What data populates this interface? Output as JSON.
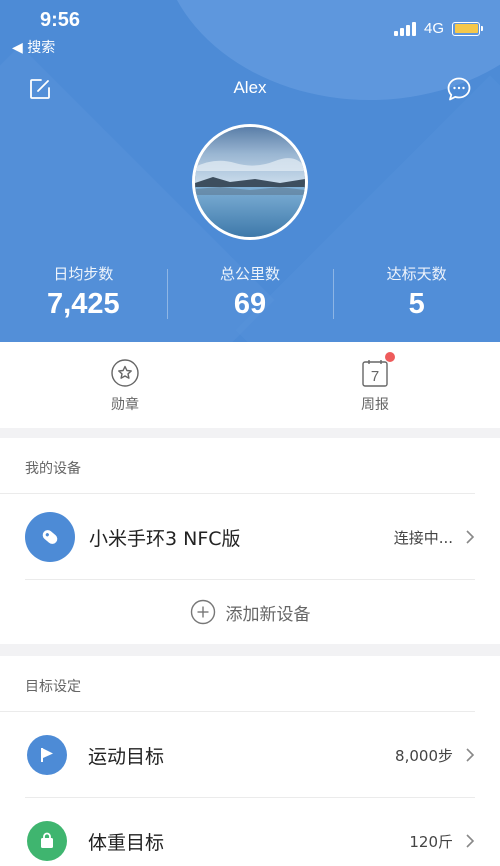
{
  "status_bar": {
    "time": "9:56",
    "back_label": "◀ 搜索",
    "network": "4G",
    "battery_color": "#f5c84a"
  },
  "header": {
    "user_name": "Alex",
    "edit_icon": "edit-icon",
    "message_icon": "message-icon",
    "background_color": "#4d8bd6"
  },
  "stats": [
    {
      "label": "日均步数",
      "value": "7,425"
    },
    {
      "label": "总公里数",
      "value": "69"
    },
    {
      "label": "达标天数",
      "value": "5"
    }
  ],
  "quick": {
    "medals_label": "勋章",
    "weekly_label": "周报",
    "weekly_icon_number": "7"
  },
  "devices": {
    "section_title": "我的设备",
    "device_name": "小米手环3 NFC版",
    "device_status": "连接中...",
    "add_label": "添加新设备"
  },
  "goals": {
    "section_title": "目标设定",
    "items": [
      {
        "label": "运动目标",
        "value": "8,000步",
        "icon": "flag-icon",
        "color": "#4d8bd6"
      },
      {
        "label": "体重目标",
        "value": "120斤",
        "icon": "bag-icon",
        "color": "#3fb56f"
      }
    ]
  }
}
